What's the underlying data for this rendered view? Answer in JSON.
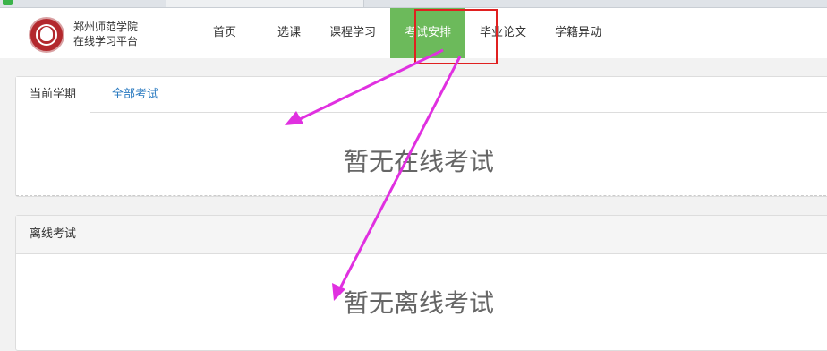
{
  "school": {
    "name": "郑州师范学院",
    "platform": "在线学习平台"
  },
  "nav": {
    "items": [
      "首页",
      "选课",
      "课程学习",
      "考试安排",
      "毕业论文",
      "学籍异动"
    ],
    "active": "考试安排"
  },
  "exam_tabs": {
    "current": "当前学期",
    "all": "全部考试"
  },
  "online_exam": {
    "empty_text": "暂无在线考试"
  },
  "offline_exam": {
    "title": "离线考试",
    "empty_text": "暂无离线考试"
  },
  "colors": {
    "nav_active": "#6cba5b",
    "highlight": "#e02020",
    "annotation_arrow": "#e030e0",
    "tab_link": "#2a7ac0"
  }
}
